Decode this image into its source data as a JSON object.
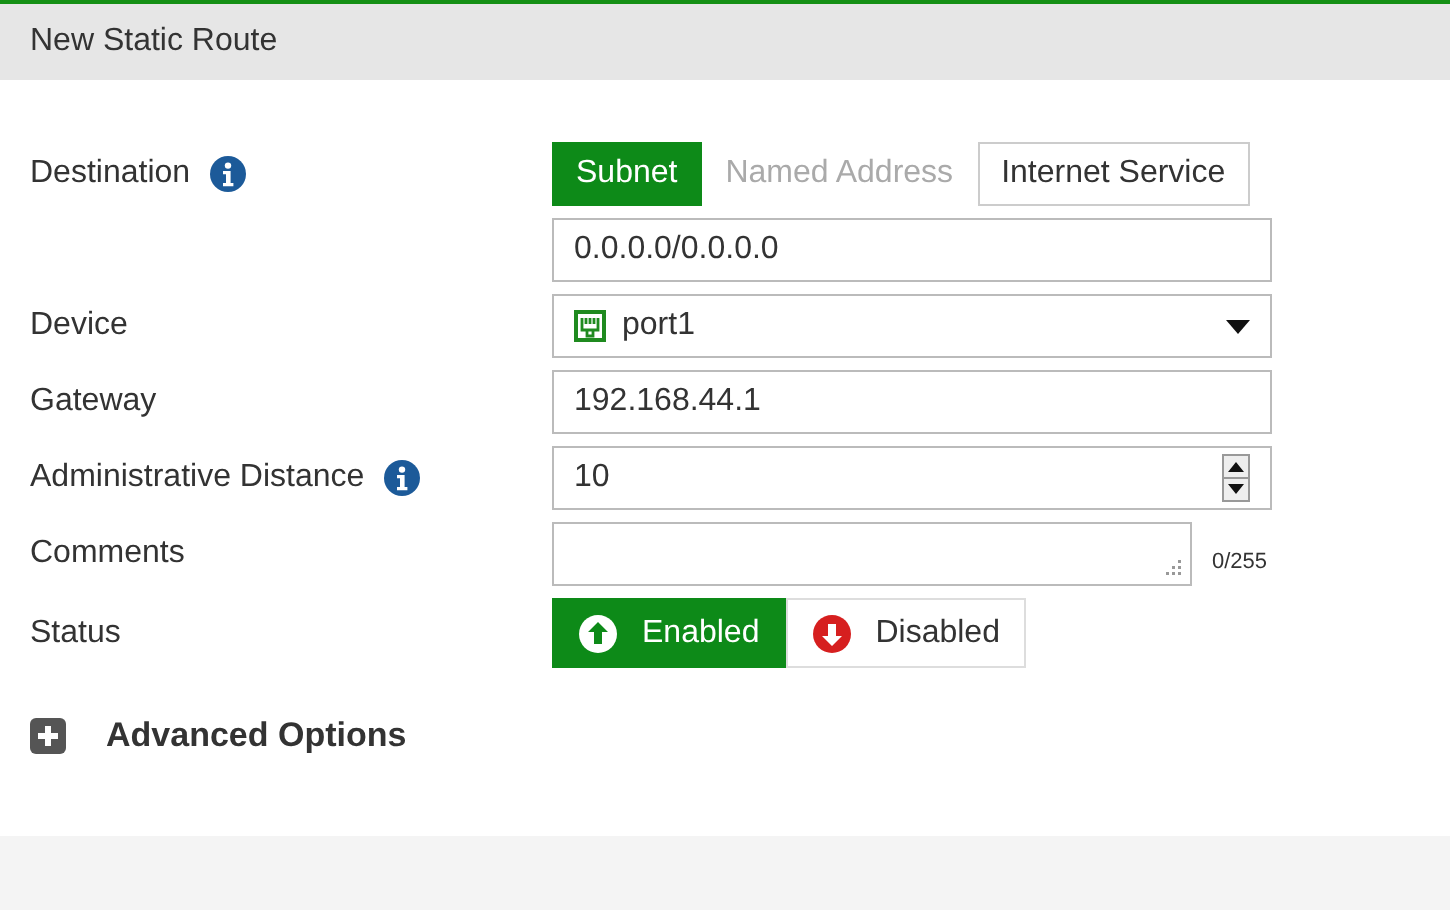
{
  "header": {
    "title": "New Static Route"
  },
  "destination": {
    "label": "Destination",
    "options": [
      {
        "label": "Subnet",
        "selected": true,
        "disabled": false
      },
      {
        "label": "Named Address",
        "selected": false,
        "disabled": true
      },
      {
        "label": "Internet Service",
        "selected": false,
        "disabled": false
      }
    ],
    "value": "0.0.0.0/0.0.0.0"
  },
  "device": {
    "label": "Device",
    "value": "port1"
  },
  "gateway": {
    "label": "Gateway",
    "value": "192.168.44.1"
  },
  "distance": {
    "label": "Administrative Distance",
    "value": "10"
  },
  "comments": {
    "label": "Comments",
    "counter": "0/255"
  },
  "status": {
    "label": "Status",
    "options": [
      {
        "label": "Enabled",
        "kind": "up",
        "selected": true
      },
      {
        "label": "Disabled",
        "kind": "down",
        "selected": false
      }
    ]
  },
  "advanced": {
    "label": "Advanced Options",
    "expanded": false
  }
}
